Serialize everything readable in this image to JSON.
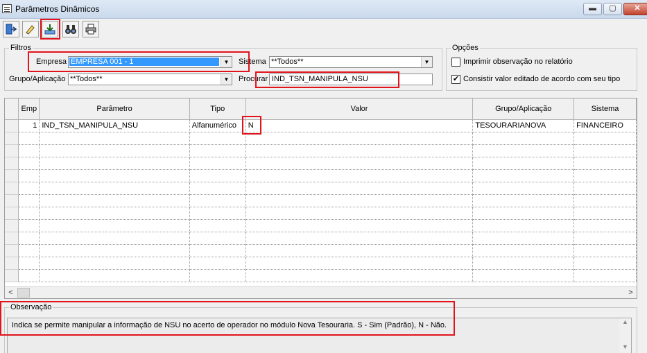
{
  "window": {
    "title": "Parâmetros Dinâmicos",
    "min_label": "▬",
    "max_label": "▢",
    "close_label": "✕"
  },
  "toolbar": {
    "items": [
      "exit-icon",
      "eraser-icon",
      "save-icon",
      "binoculars-icon",
      "printer-icon"
    ]
  },
  "filters": {
    "group_label": "Filtros",
    "empresa_label": "Empresa",
    "empresa_value": "EMPRESA 001 - 1",
    "sistema_label": "Sistema",
    "sistema_value": "**Todos**",
    "grupo_label": "Grupo/Aplicação",
    "grupo_value": "**Todos**",
    "procurar_label": "Procurar",
    "procurar_value": "IND_TSN_MANIPULA_NSU"
  },
  "options": {
    "group_label": "Opções",
    "imprimir_label": "Imprimir observação no relatório",
    "imprimir_checked": false,
    "consistir_label": "Consistir valor editado de acordo com seu tipo",
    "consistir_checked": true
  },
  "grid": {
    "columns": [
      "Emp",
      "Parâmetro",
      "Tipo",
      "Valor",
      "Grupo/Aplicação",
      "Sistema"
    ],
    "rows": [
      {
        "emp": "1",
        "parametro": "IND_TSN_MANIPULA_NSU",
        "tipo": "Alfanumérico",
        "valor": "N",
        "grupo": "TESOURARIANOVA",
        "sistema": "FINANCEIRO"
      }
    ],
    "empty_rows": 12,
    "scroll_left": "<",
    "scroll_right": ">"
  },
  "observacao": {
    "group_label": "Observação",
    "text": "Indica se permite manipular a informação de NSU no acerto de operador no módulo Nova Tesouraria. S - Sim (Padrão), N - Não."
  },
  "colors": {
    "highlight": "#e1141c",
    "selection": "#3399ff"
  }
}
